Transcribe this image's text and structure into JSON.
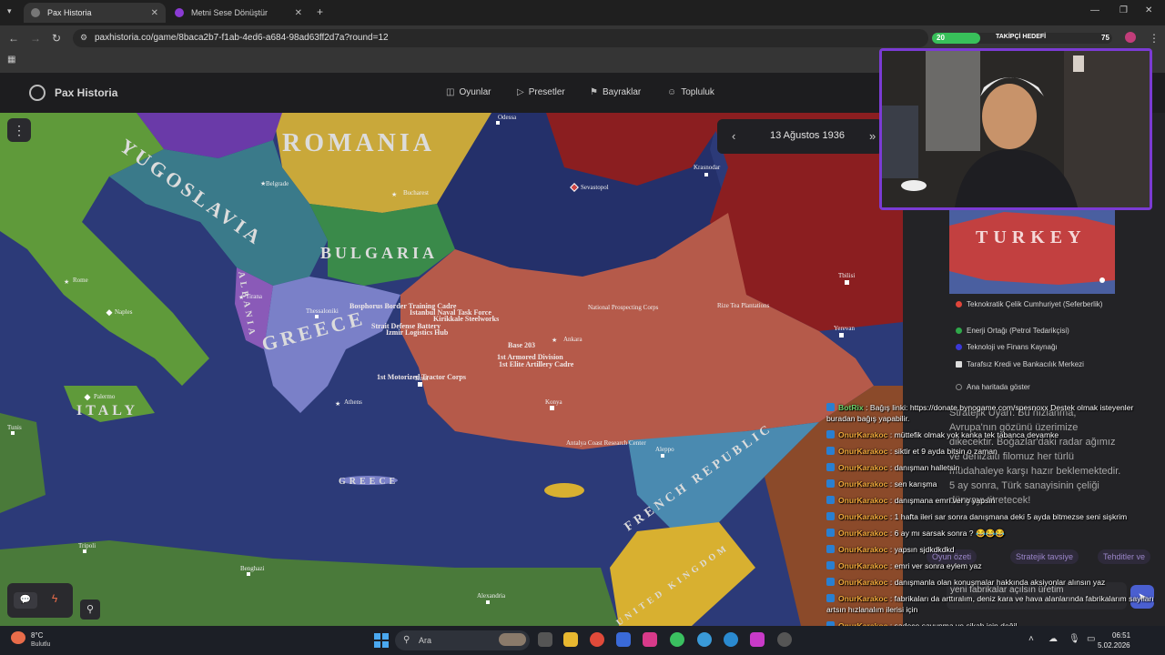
{
  "browser": {
    "tabs": [
      {
        "label": "Pax Historia",
        "active": true
      },
      {
        "label": "Metni Sese Dönüştür",
        "active": false
      }
    ],
    "url": "paxhistoria.co/game/8baca2b7-f1ab-4ed6-a684-98ad63ff2d7a?round=12"
  },
  "site": {
    "logo": "Pax Historia",
    "nav": [
      "Oyunlar",
      "Presetler",
      "Bayraklar",
      "Topluluk"
    ]
  },
  "date_nav": {
    "date": "13 Ağustos 1936"
  },
  "map": {
    "countries": [
      "ROMANIA",
      "YUGOSLAVIA",
      "BULGARIA",
      "ALBANIA",
      "GREECE",
      "ITALY",
      "FRENCH REPUBLIC",
      "GREECE"
    ],
    "cities": [
      "Odessa",
      "Sevastopol",
      "Krasnodar",
      "Belgrade",
      "Bucharest",
      "Tirana",
      "Rome",
      "Naples",
      "Palermo",
      "Athens",
      "Ankara",
      "Tunis",
      "Tripoli",
      "Benghazi",
      "Alexandria",
      "Aleppo",
      "Tbilisi",
      "Yerevan",
      "Thessaloniki",
      "Konya",
      "Izmir"
    ],
    "units": [
      "Strait Defense Battery",
      "Izmir Logistics Hub",
      "1st Motorized Tractor Corps",
      "Base 203",
      "1st Armored Division",
      "1st Elite Artillery Cadre",
      "Kirikkale Steelworks",
      "Istanbul Naval Task Force",
      "Rize Tea Plantations",
      "National Prospecting Corps",
      "Antalya Coast Research Center",
      "Bosphorus Border Training Cadre"
    ],
    "kingdom_label": "UNITED KINGDOM"
  },
  "panel": {
    "country": "TURKEY",
    "options": [
      {
        "label": "Teknokratik Çelik Cumhuriyet (Seferberlik)",
        "color": "#e0453a"
      },
      {
        "label": "Enerji Ortağı (Petrol Tedarikçisi)",
        "color": "#2fa84a"
      },
      {
        "label": "Teknoloji ve Finans Kaynağı",
        "color": "#3b38d8"
      },
      {
        "label": "Tarafsız Kredi ve Bankacılık Merkezi",
        "color": "#dddddd"
      }
    ],
    "show_on_map": "Ana haritada göster",
    "advisor_text": "Stratejik Uyarı: Bu hızlanma, Avrupa'nın gözünü üzerimize dikecektir. Boğazlar'daki radar ağımız ve denizaltı filomuz her türlü müdahaleye karşı hazır beklemektedir. 5 ay sonra, Türk sanayisinin çeliği dünyayı titretecek!",
    "suggestions": [
      "Oyun özeti",
      "Stratejik tavsiye",
      "Tehditler ve"
    ],
    "input_text": "yeni fabrikalar açılsın üretim"
  },
  "stream": {
    "follower_left": "20",
    "follower_goal_label": "TAKİPÇİ HEDEFİ",
    "follower_right": "75",
    "follower_progress": 0.27
  },
  "chat": [
    {
      "user": "BotRix",
      "bot": true,
      "text": "Bağış linki: https://donate.bynogame.com/spesnoxx Destek olmak isteyenler buradan bağış yapabilir."
    },
    {
      "user": "OnurKarakoc",
      "text": "müttefik olmak yok kanka tek tabanca devamke"
    },
    {
      "user": "OnurKarakoc",
      "text": "siktir et 9 ayda bitsin o zaman"
    },
    {
      "user": "OnurKarakoc",
      "text": "danışman halletsin"
    },
    {
      "user": "OnurKarakoc",
      "text": "sen karışma"
    },
    {
      "user": "OnurKarakoc",
      "text": "danışmana emri ver o yapsın"
    },
    {
      "user": "OnurKarakoc",
      "text": "1 hafta ileri sar sonra danışmana deki 5 ayda bitmezse seni sişkrim"
    },
    {
      "user": "OnurKarakoc",
      "text": "6 ay mı sarsak sonra ? 😂😂😂"
    },
    {
      "user": "OnurKarakoc",
      "text": "yapsın sjdkdkdkd"
    },
    {
      "user": "OnurKarakoc",
      "text": "emri ver sonra eylem yaz"
    },
    {
      "user": "OnurKarakoc",
      "text": "danışmanla olan konuşmalar hakkında aksiyonlar alınsın yaz"
    },
    {
      "user": "OnurKarakoc",
      "text": "fabrikaları da arttıralım, deniz kara ve hava alanlarında fabrikalarım sayıları artsın hızlanalım ilerisi için"
    },
    {
      "user": "OnurKarakoc",
      "text": "sadece savunma ve sikah için değil"
    }
  ],
  "taskbar": {
    "weather_temp": "8°C",
    "weather_desc": "Bulutlu",
    "search_placeholder": "Ara",
    "time": "06:51",
    "date": "5.02.2026"
  }
}
